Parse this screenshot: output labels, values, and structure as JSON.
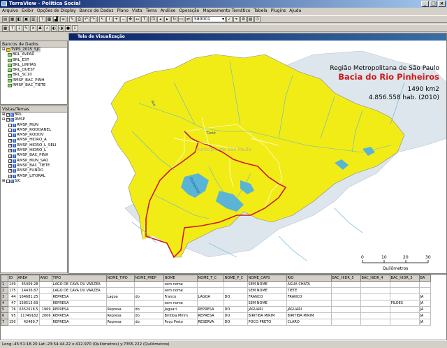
{
  "window": {
    "title": "TerraView - Politica Social",
    "buttons": [
      "_",
      "□",
      "×"
    ]
  },
  "menu": [
    "Arquivo",
    "Exibir",
    "Opções de Display",
    "Banco de Dados",
    "Plano",
    "Vista",
    "Tema",
    "Análise",
    "Operação",
    "Mapeamento Temático",
    "Tabela",
    "Plugins",
    "Ajuda"
  ],
  "toolbar": {
    "scale_value": "580001"
  },
  "db_panel": {
    "title": "Bancos de Dados",
    "items": [
      "TVPS_2015_SJC",
      "BRL_AVPAR",
      "BRL_EST",
      "BRL_LINHAS",
      "BRL_QUEST",
      "BRL_SC10",
      "RMSP_BAC_PINH",
      "RMSP_BAC_TIETE"
    ]
  },
  "views_panel": {
    "title": "Vistas/Temas",
    "items": [
      "BRL",
      "RMSP",
      "RMSP_MUN",
      "RMSP_RODOANEL",
      "RMSP_RODOV",
      "RMSP_HIDRO_A",
      "RMSP_HIDRO_L_SELI",
      "RMSP_HIDRO_L",
      "RMSP_BAC_PINH",
      "RMSP_MUN_SAO",
      "RMSP_BAC_TIETE",
      "RMSP_FUNDO",
      "RMSP_LITORAL",
      "SJC"
    ]
  },
  "map": {
    "window_title": "Tela de Visualização",
    "region": "Região Metropolitana de São Paulo",
    "basin": "Bacia do Rio Pinheiros",
    "area": "1490 km2",
    "population": "4.856.558 hab. (2010)",
    "labels": {
      "rio": "Rio",
      "tiete": "Tietê",
      "sp": "Município de São Paulo",
      "pinheiros": "Pinheiros"
    },
    "scale": {
      "ticks": [
        "0",
        "10",
        "20",
        "30"
      ],
      "unit": "Quilômetros"
    },
    "colors": {
      "basin_yellow": "#f2ec16",
      "outside": "#dde6ec",
      "boundary": "#cc1a1a",
      "water": "#5ab4d6"
    }
  },
  "table": {
    "headers": [
      "",
      "ID",
      "AREA",
      "ANO",
      "TIPO",
      "NOME_TIPO",
      "NOME_PREP",
      "NOME",
      "NOME_T_C",
      "NOME_P_C",
      "NOME_CAPS",
      "RIO",
      "BAC_HIDR_5",
      "BAC_HIDR_4",
      "BAC_HIDR_3",
      "BA"
    ],
    "rows": [
      [
        "1",
        "149",
        "45409.28",
        "",
        "LAGO DE CAVA OU VARZEA",
        "",
        "",
        "sem nome",
        "",
        "",
        "SEM NOME",
        "AGUA CHATA",
        "",
        "",
        "",
        ""
      ],
      [
        "2",
        "175",
        "14436.87",
        "",
        "LAGO DE CAVA OU VARZEA",
        "",
        "",
        "sem nome",
        "",
        "",
        "SEM NOME",
        "TIETE",
        "",
        "",
        "",
        ""
      ],
      [
        "3",
        "44",
        "164681.25",
        "",
        "REPRESA",
        "Lagoa",
        "do",
        "Franco",
        "LAGOA",
        "DO",
        "FRANCO",
        "FRANCO",
        "",
        "",
        "",
        "JA"
      ],
      [
        "4",
        "47",
        "158513.69",
        "",
        "REPRESA",
        "",
        "",
        "sem nome",
        "",
        "",
        "SEM NOME",
        "",
        "",
        "",
        "PILOES",
        "JA"
      ],
      [
        "5",
        "76",
        "6352018.5",
        "1969",
        "REPRESA",
        "Represa",
        "do",
        "Jaguari",
        "REPRESA",
        "DO",
        "JAGUARI",
        "JAGUARI",
        "",
        "",
        "",
        "JA"
      ],
      [
        "6",
        "95",
        "11749182",
        "2006",
        "REPRESA",
        "Represa",
        "do",
        "Biritiba Mirim",
        "REPRESA",
        "DO",
        "BIRITIBA MIRIM",
        "BIRITIBA MIRIM",
        "",
        "",
        "",
        "JA"
      ],
      [
        "7",
        "150",
        "42489.7",
        "",
        "REPRESA",
        "Represa",
        "do",
        "Poço Preto",
        "RESERVA",
        "DO",
        "POCO PRETO",
        "CLARO",
        "",
        "",
        "",
        "JA"
      ]
    ]
  },
  "status": "Long:-45:51:18.20 Lat:-23:54:44.22  x:412.970 (Quilômetros) y:7355.222 (Quilômetros)"
}
